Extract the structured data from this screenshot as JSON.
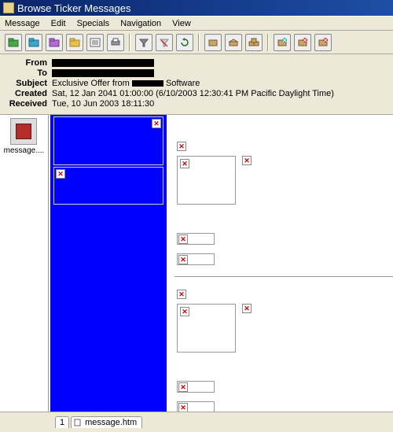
{
  "title": "Browse Ticker Messages",
  "menu": {
    "message": "Message",
    "edit": "Edit",
    "specials": "Specials",
    "navigation": "Navigation",
    "view": "View"
  },
  "headers": {
    "from": {
      "label": "From"
    },
    "to": {
      "label": "To"
    },
    "subject": {
      "label": "Subject",
      "value_prefix": "Exclusive Offer from ",
      "value_suffix": " Software"
    },
    "created": {
      "label": "Created",
      "value": "Sat, 12 Jan 2041  01:00:00  (6/10/2003 12:30:41 PM Pacific Daylight Time)"
    },
    "received": {
      "label": "Received",
      "value": "Tue, 10 Jun 2003  18:11:30"
    }
  },
  "sidebar": {
    "thumb_label": "message...."
  },
  "status": {
    "tab_index": "1",
    "tab_label": "message.htm"
  },
  "toolbar": {
    "icons": [
      "folder-green",
      "folder-cyan",
      "folder-purple",
      "folder-yellow",
      "list-icon",
      "print-icon",
      "sep",
      "filter-icon",
      "filter-clear-icon",
      "refresh-icon",
      "sep",
      "box-icon",
      "box-open-icon",
      "box-stacked-icon",
      "sep",
      "box-x-teal",
      "box-x-red",
      "box-x-red2"
    ]
  },
  "broken_glyph": "✕"
}
